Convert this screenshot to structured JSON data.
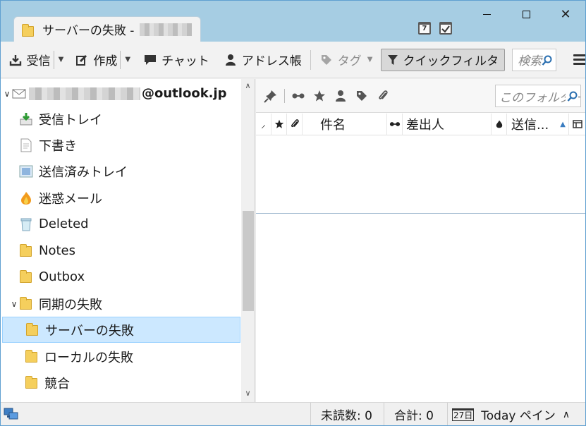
{
  "window": {
    "tab_title": "サーバーの失敗 -",
    "controls": {
      "minimize": "minimize-icon",
      "maximize": "maximize-icon",
      "close": "✕"
    }
  },
  "titlebar_icons": {
    "calendar_day": "7",
    "tasks": "tasks-icon"
  },
  "toolbar": {
    "get_messages": "受信",
    "write": "作成",
    "chat": "チャット",
    "address_book": "アドレス帳",
    "tag": "タグ",
    "quick_filter": "クイックフィルタ",
    "search_placeholder": "検索"
  },
  "account": {
    "email_suffix": "@outlook.jp"
  },
  "folders": [
    {
      "label": "受信トレイ",
      "icon": "inbox-icon"
    },
    {
      "label": "下書き",
      "icon": "drafts-icon"
    },
    {
      "label": "送信済みトレイ",
      "icon": "sent-icon"
    },
    {
      "label": "迷惑メール",
      "icon": "junk-icon"
    },
    {
      "label": "Deleted",
      "icon": "trash-icon"
    },
    {
      "label": "Notes",
      "icon": "folder-icon"
    },
    {
      "label": "Outbox",
      "icon": "folder-icon"
    },
    {
      "label": "同期の失敗",
      "icon": "folder-icon"
    },
    {
      "label": "サーバーの失敗",
      "icon": "folder-icon",
      "selected": true
    },
    {
      "label": "ローカルの失敗",
      "icon": "folder-icon"
    },
    {
      "label": "競合",
      "icon": "folder-icon"
    }
  ],
  "filter": {
    "search_placeholder": "このフォルダー"
  },
  "columns": {
    "subject": "件名",
    "sender": "差出人",
    "date": "送信..."
  },
  "status": {
    "unread": "未読数: 0",
    "total": "合計: 0",
    "today_pane": "Today ペイン",
    "today_icon_text": "27日"
  }
}
